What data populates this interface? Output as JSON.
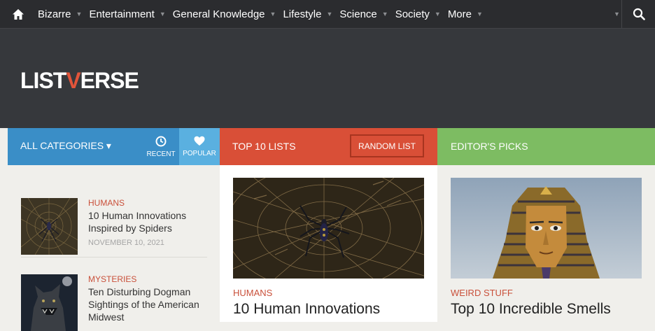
{
  "nav": {
    "items": [
      {
        "label": "Bizarre"
      },
      {
        "label": "Entertainment"
      },
      {
        "label": "General Knowledge"
      },
      {
        "label": "Lifestyle"
      },
      {
        "label": "Science"
      },
      {
        "label": "Society"
      },
      {
        "label": "More"
      }
    ]
  },
  "logo": {
    "part1": "LIST",
    "v": "V",
    "part2": "ERSE"
  },
  "columns": {
    "categories_label": "ALL CATEGORIES ▾",
    "recent_label": "RECENT",
    "popular_label": "POPULAR",
    "top10_label": "TOP 10 LISTS",
    "random_label": "RANDOM LIST",
    "editors_label": "EDITOR'S PICKS"
  },
  "recent_list": [
    {
      "category": "HUMANS",
      "title": "10 Human Innovations Inspired by Spiders",
      "date": "NOVEMBER 10, 2021"
    },
    {
      "category": "MYSTERIES",
      "title": "Ten Disturbing Dogman Sightings of the American Midwest"
    }
  ],
  "top10": {
    "category": "HUMANS",
    "title": "10 Human Innovations"
  },
  "editors": {
    "category": "WEIRD STUFF",
    "title": "Top 10 Incredible Smells"
  },
  "colors": {
    "blue": "#3a8ec7",
    "red": "#d94f37",
    "green": "#7dbc62",
    "accent": "#c9503a"
  }
}
